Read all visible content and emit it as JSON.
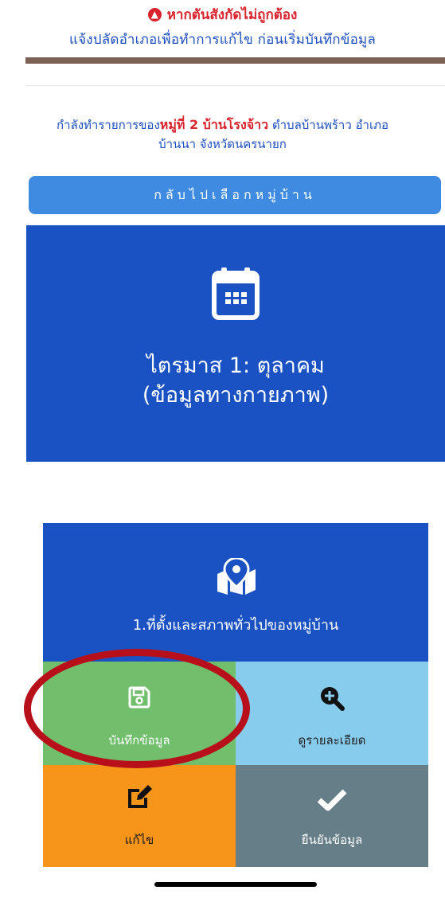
{
  "warning": {
    "line1": "หากตันสังกัดไม่ถูกต้อง",
    "line2": "แจ้งปลัดอำเภอเพื่อทำการแก้ไข ก่อนเริ่มบันทึกข้อมูล"
  },
  "location": {
    "prefix": "กำลังทำรายการของ",
    "village": "หมู่ที่ 2 บ้านโรงจ้าว",
    "rest": " ตำบลบ้านพร้าว อำเภอ",
    "line2": "บ้านนา จังหวัดนครนายก"
  },
  "back_button": {
    "label": "กลับไปเลือกหมู่บ้าน"
  },
  "section": {
    "title_line1": "ไตรมาส 1: ตุลาคม",
    "title_line2": "(ข้อมูลทางกายภาพ)"
  },
  "topic": {
    "title": "1.ที่ตั้งและสภาพทั่วไปของหมู่บ้าน"
  },
  "actions": {
    "record_label": "บันทึกข้อมูล",
    "detail_label": "ดูรายละเอียด",
    "edit_label": "แก้ไข",
    "confirm_label": "ยืนยันข้อมูล"
  },
  "icons": {
    "warning": "arrow-up-circle-icon",
    "calendar": "calendar-icon",
    "map": "map-marker-icon",
    "record": "save-icon",
    "detail": "zoom-in-icon",
    "edit": "edit-icon",
    "confirm": "check-icon"
  },
  "colors": {
    "warning_red": "#d9232d",
    "link_blue": "#1e4fbf",
    "primary_blue": "#1b52c3",
    "button_blue": "#3f8be2",
    "green": "#71bf6c",
    "light_blue": "#87ccec",
    "orange": "#f7941a",
    "slate": "#667e88",
    "highlight_red": "#b8101a"
  }
}
